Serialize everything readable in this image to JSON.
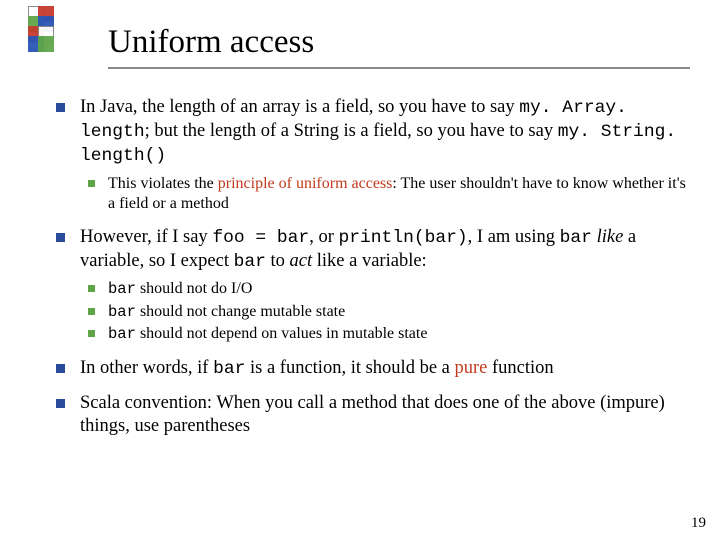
{
  "page_number": "19",
  "title": "Uniform access",
  "b1": {
    "pre": "In Java, the length of an array is a field, so you have to say ",
    "code1": "my. Array. length",
    "mid": "; but the length of a String is a field, so you have to say ",
    "code2": "my. String. length()",
    "sub": {
      "pre": "This violates the ",
      "emph": "principle of uniform access",
      "post": ": The user shouldn't have to know whether it's a field or a method"
    }
  },
  "b2": {
    "pre": "However, if I say ",
    "code1": "foo = bar",
    "mid1": ", or ",
    "code2": "println(bar)",
    "mid2": ", I am using ",
    "code3": "bar",
    "mid3": " ",
    "ital1": "like",
    "mid4": " a variable, so I expect ",
    "code4": "bar",
    "mid5": " to ",
    "ital2": "act",
    "post": " like a variable:",
    "s1": {
      "code": "bar",
      "text": " should not do I/O"
    },
    "s2": {
      "code": "bar",
      "text": " should not change mutable state"
    },
    "s3": {
      "code": "bar",
      "text": " should not depend on values in mutable state"
    }
  },
  "b3": {
    "pre": "In other words, if ",
    "code": "bar",
    "mid": " is a function, it should be a ",
    "emph": "pure",
    "post": " function"
  },
  "b4": "Scala convention: When you call a method that does one of the above (impure) things, use parentheses"
}
